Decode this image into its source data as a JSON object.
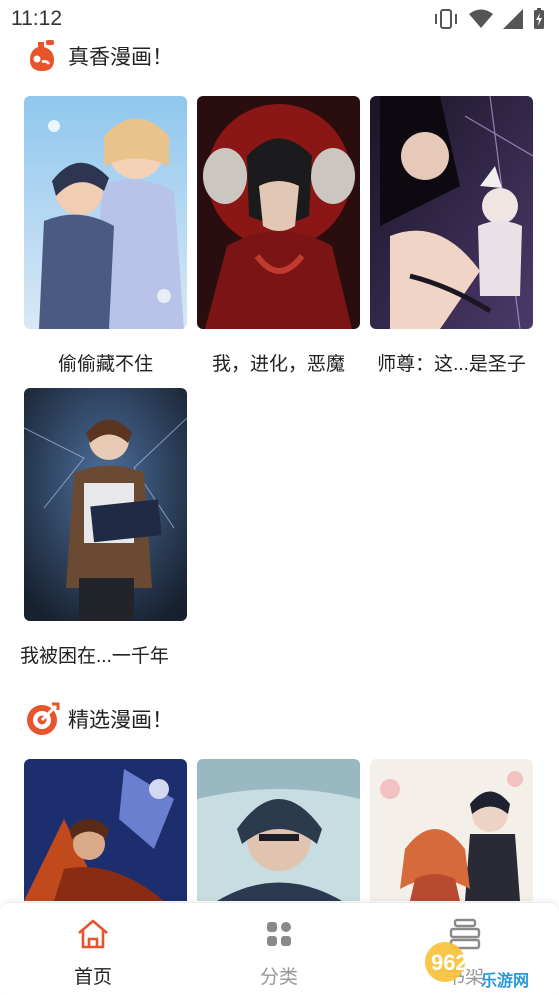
{
  "status_bar": {
    "time": "11:12",
    "icons": [
      "vibrate-icon",
      "wifi-icon",
      "signal-icon",
      "battery-charging-icon"
    ]
  },
  "sections": [
    {
      "title": "真香漫画！",
      "icon": "flask-icon",
      "accent": "#e8542c",
      "items": [
        {
          "title": "偷偷藏不住"
        },
        {
          "title": "我，进化，恶魔"
        },
        {
          "title": "师尊：这...是圣子"
        },
        {
          "title": "我被困在...一千年"
        }
      ]
    },
    {
      "title": "精选漫画！",
      "icon": "target-icon",
      "accent": "#e8542c",
      "items": [
        {},
        {},
        {}
      ]
    }
  ],
  "bottom_nav": {
    "items": [
      {
        "label": "首页",
        "icon": "home-icon",
        "active": true
      },
      {
        "label": "分类",
        "icon": "grid-icon",
        "active": false
      },
      {
        "label": "书架",
        "icon": "bookshelf-icon",
        "active": false
      }
    ],
    "active_color": "#e8542c",
    "inactive_color": "#999999"
  },
  "watermark": {
    "text": "962.NET",
    "subtext": "乐游网"
  }
}
